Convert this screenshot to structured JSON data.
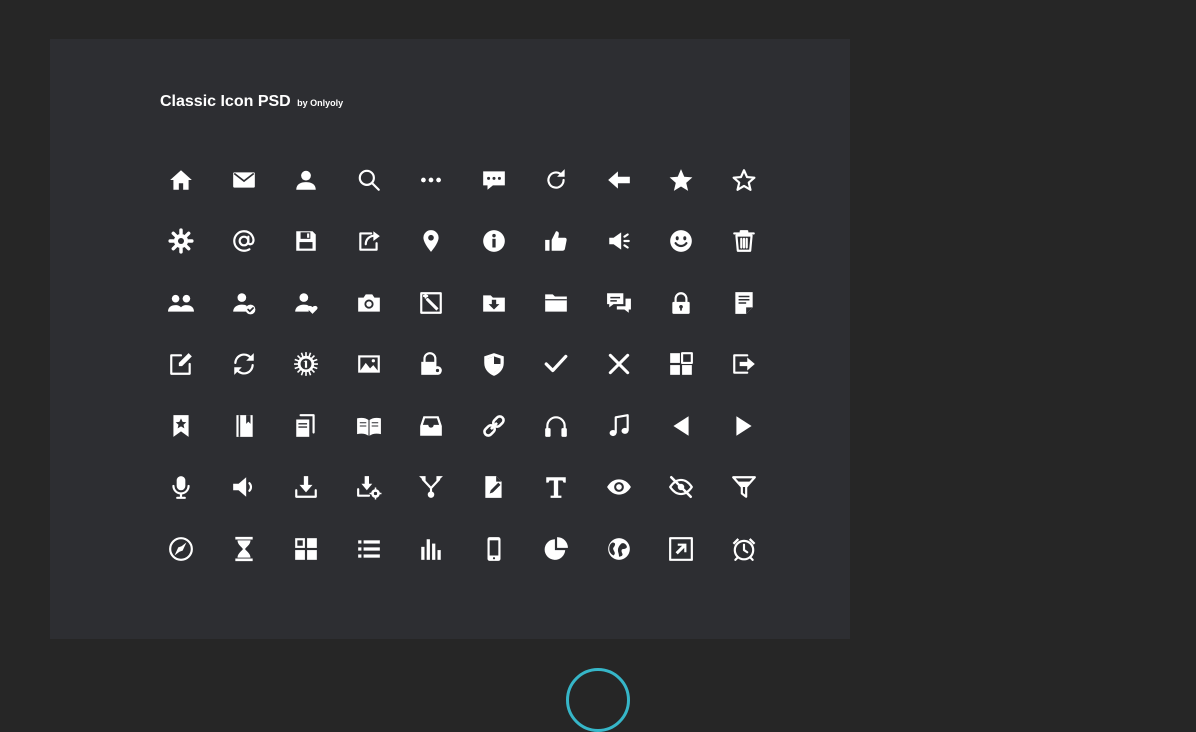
{
  "header": {
    "title": "Classic Icon PSD",
    "byline": "by Onlyoly"
  },
  "colors": {
    "background": "#262626",
    "panel": "#2d2e32",
    "icon": "#ffffff",
    "accent": "#36b6c8"
  },
  "icons": [
    "home-icon",
    "mail-icon",
    "user-icon",
    "search-icon",
    "more-dots-icon",
    "chat-icon",
    "refresh-icon",
    "arrow-left-icon",
    "star-filled-icon",
    "star-outline-icon",
    "gear-icon",
    "at-icon",
    "save-icon",
    "share-icon",
    "location-pin-icon",
    "info-icon",
    "thumbs-up-icon",
    "speaker-announce-icon",
    "smiley-icon",
    "trash-icon",
    "users-icon",
    "user-check-icon",
    "user-heart-icon",
    "camera-icon",
    "image-edit-icon",
    "folder-download-icon",
    "folder-icon",
    "chat-bubbles-icon",
    "lock-icon",
    "document-icon",
    "edit-icon",
    "sync-icon",
    "badge-icon",
    "picture-icon",
    "lock-settings-icon",
    "shield-icon",
    "checkmark-icon",
    "close-icon",
    "dashboard-icon",
    "sign-out-icon",
    "bookmark-star-icon",
    "book-icon",
    "books-icon",
    "open-book-icon",
    "inbox-icon",
    "link-icon",
    "headphones-icon",
    "music-note-icon",
    "play-left-icon",
    "play-right-icon",
    "microphone-icon",
    "volume-icon",
    "download-icon",
    "download-settings-icon",
    "fork-icon",
    "document-edit-icon",
    "text-icon",
    "eye-icon",
    "eye-off-icon",
    "filter-icon",
    "compass-icon",
    "hourglass-icon",
    "tiles-icon",
    "list-icon",
    "bar-chart-icon",
    "mobile-icon",
    "pie-chart-icon",
    "globe-icon",
    "external-link-icon",
    "alarm-clock-icon"
  ]
}
